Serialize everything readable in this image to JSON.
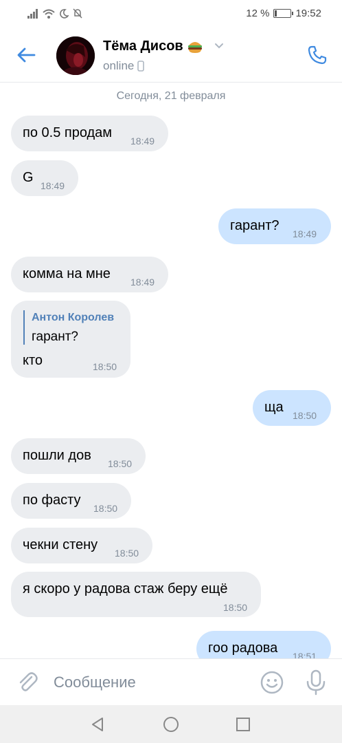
{
  "status_bar": {
    "battery": "12 %",
    "time": "19:52",
    "battery_level": 0.12
  },
  "header": {
    "name": "Тёма Дисов",
    "name_emoji": "🍔",
    "status": "online"
  },
  "chat": {
    "date_separator": "Сегодня, 21 февраля",
    "messages": [
      {
        "dir": "in",
        "text": "по 0.5 продам",
        "time": "18:49"
      },
      {
        "dir": "in",
        "text": "G",
        "time": "18:49"
      },
      {
        "dir": "out",
        "text": "гарант?",
        "time": "18:49"
      },
      {
        "dir": "in",
        "text": "комма на мне",
        "time": "18:49"
      },
      {
        "dir": "in",
        "reply_author": "Антон Королев",
        "reply_text": "гарант?",
        "text": "кто",
        "time": "18:50"
      },
      {
        "dir": "out",
        "text": "ща",
        "time": "18:50"
      },
      {
        "dir": "in",
        "text": "пошли дов",
        "time": "18:50"
      },
      {
        "dir": "in",
        "text": "по фасту",
        "time": "18:50"
      },
      {
        "dir": "in",
        "text": "чекни стену",
        "time": "18:50"
      },
      {
        "dir": "in",
        "text": "я скоро у радова стаж беру ещё",
        "time": "18:50"
      },
      {
        "dir": "out",
        "text": "гоо радова",
        "time": "18:51"
      }
    ]
  },
  "composer": {
    "placeholder": "Сообщение"
  },
  "colors": {
    "accent": "#3f8ae0",
    "incoming_bubble": "#ebedf0",
    "outgoing_bubble": "#cce4ff",
    "secondary_text": "#818c99"
  },
  "icons": {
    "back": "arrow-left-icon",
    "call": "phone-icon",
    "attach": "paperclip-icon",
    "emoji": "smile-icon",
    "voice": "microphone-icon"
  }
}
